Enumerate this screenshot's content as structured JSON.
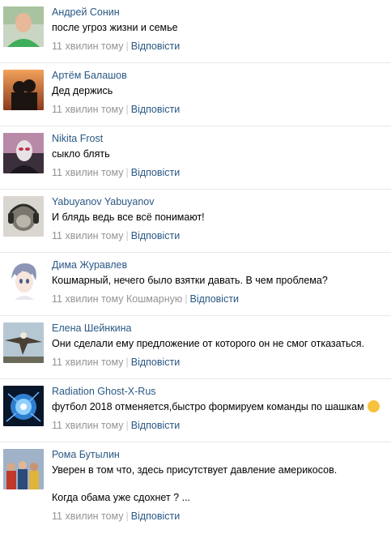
{
  "comments": [
    {
      "author": "Андрей Сонин",
      "text": "после угроз жизни и семье",
      "time": "11 хвилин тому",
      "reply": "Відповісти",
      "avatar": "green-shirt-man-photo"
    },
    {
      "author": "Артём Балашов",
      "text": "Дед держись",
      "time": "11 хвилин тому",
      "reply": "Відповісти",
      "avatar": "sunset-couple-photo"
    },
    {
      "author": "Nikita Frost",
      "text": "сыкло блять",
      "time": "11 хвилин тому",
      "reply": "Відповісти",
      "avatar": "masked-figure-photo"
    },
    {
      "author": "Yabuyanov Yabuyanov",
      "text": "И блядь ведь все всё понимают!",
      "time": "11 хвилин тому",
      "reply": "Відповісти",
      "avatar": "monkey-headphones-sketch"
    },
    {
      "author": "Дима Журавлев",
      "text": "Кошмарный, нечего было взятки давать. В чем проблема?",
      "time": "11 хвилин тому",
      "mention": "Кошмарную",
      "reply": "Відповісти",
      "avatar": "anime-boy-drawing"
    },
    {
      "author": "Елена Шейнкина",
      "text": "Они сделали ему предложение от которого он не смог отказаться.",
      "time": "11 хвилин тому",
      "reply": "Відповісти",
      "avatar": "eagle-photo"
    },
    {
      "author": "Radiation Ghost-X-Rus",
      "text": "футбол 2018 отменяется,быстро формируем команды по шашкам",
      "emoji": "laughing-emoji",
      "time": "11 хвилин тому",
      "reply": "Відповісти",
      "avatar": "blue-energy-orb"
    },
    {
      "author": "Рома Бутылин",
      "text": "Уверен в том что, здесь присутствует давление америкосов.\n\nКогда обама уже сдохнет ? ...",
      "time": "11 хвилин тому",
      "reply": "Відповісти",
      "avatar": "crowd-group-photo"
    }
  ]
}
